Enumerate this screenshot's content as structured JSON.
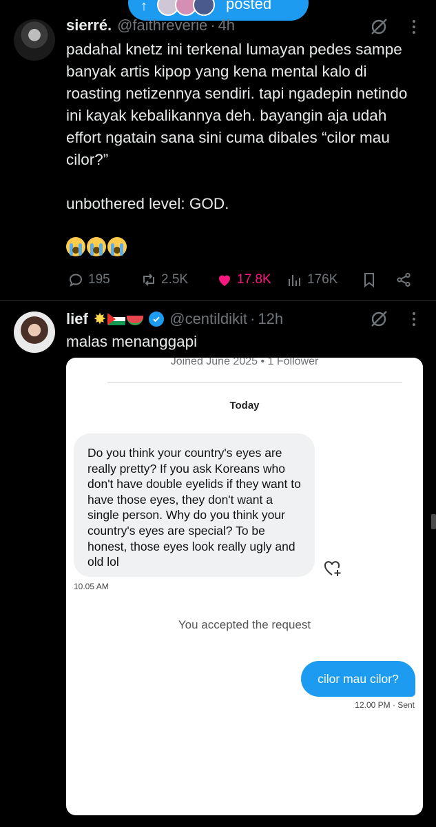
{
  "banner": {
    "arrow": "↑",
    "label": "posted"
  },
  "tweet1": {
    "name": "sierré.",
    "handle": "@faithreverie",
    "dot": "·",
    "time": "4h",
    "text": "padahal knetz ini terkenal lumayan pedes sampe banyak artis kipop yang kena mental kalo di roasting netizennya sendiri. tapi ngadepin netindo ini kayak kebalikannya deh. bayangin aja udah effort ngatain sana sini cuma dibales “cilor mau cilor?”\n\nunbothered level: GOD.",
    "emoji_icons": [
      "loudly-crying-face",
      "loudly-crying-face",
      "loudly-crying-face"
    ],
    "replies": "195",
    "reposts": "2.5K",
    "likes": "17.8K",
    "views": "176K",
    "like_color": "#f91880"
  },
  "tweet2": {
    "name": "lief",
    "name_emoji_icons": [
      "glowing-star",
      "palestine-flag",
      "watermelon"
    ],
    "handle": "@centildikit",
    "dot": "·",
    "time": "12h",
    "text": "malas menanggapi"
  },
  "dm_screenshot": {
    "joined": "Joined June 2025 • 1 Follower",
    "date_header": "Today",
    "incoming_message": "Do you think your country's eyes are really pretty? If you ask Koreans who don't have double eyelids if they want to have those eyes, they don't want a single person. Why do you think your country's eyes are special? To be honest, those eyes look really ugly and old lol",
    "incoming_time": "10.05 AM",
    "system_message": "You accepted the request",
    "outgoing_message": "cilor mau cilor?",
    "outgoing_time": "12.00 PM  · Sent",
    "accent": "#1d9bf0"
  }
}
